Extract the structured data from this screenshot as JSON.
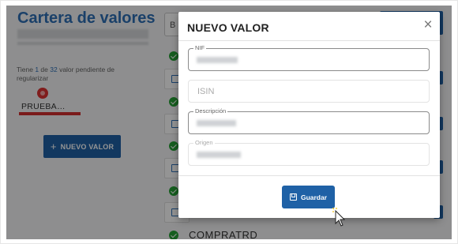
{
  "page": {
    "title": "Cartera de valores",
    "pending_prefix": "Tiene ",
    "pending_count": "1",
    "pending_of": " de ",
    "pending_total": "32",
    "pending_suffix": " valor pendiente de regularizar",
    "prueba_label": "PRUEBA…",
    "new_value_button": "NUEVO VALOR",
    "search_char": "B",
    "list_visible_item": "COMPRATRD"
  },
  "modal": {
    "title": "NUEVO VALOR",
    "close_glyph": "×",
    "fields": [
      {
        "label": "NIF",
        "placeholder": ""
      },
      {
        "label": "",
        "placeholder": "ISIN"
      },
      {
        "label": "Descripción",
        "placeholder": ""
      },
      {
        "label": "Origen",
        "placeholder": ""
      }
    ],
    "save_label": "Guardar"
  },
  "colors": {
    "primary": "#1f61a6",
    "title_blue": "#2d6fb6",
    "danger": "#d32f2f",
    "success": "#27a336"
  },
  "icons": {
    "save": "floppy-disk-icon",
    "add": "plus-icon",
    "close": "close-icon"
  }
}
